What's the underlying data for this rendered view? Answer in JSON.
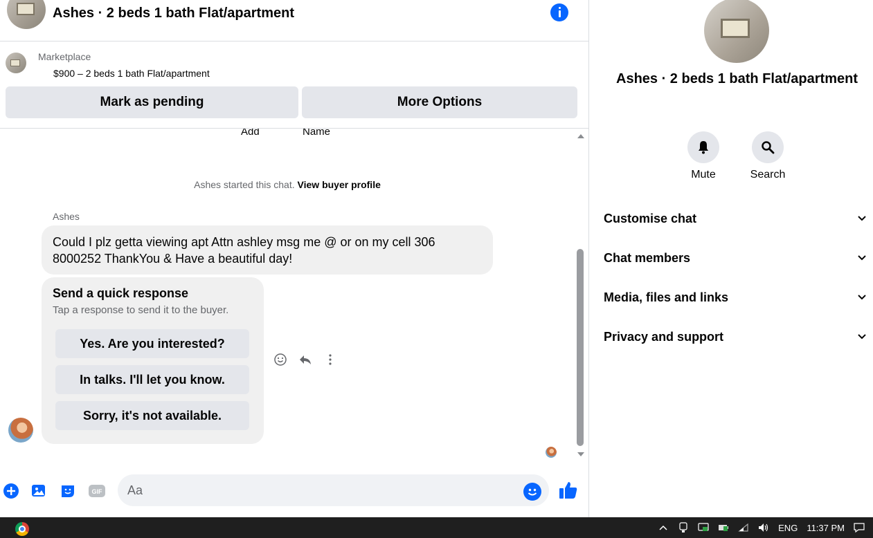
{
  "header": {
    "title": "Ashes · 2 beds 1 bath Flat/apartment"
  },
  "listing": {
    "source": "Marketplace",
    "price_title": "$900 – 2 beds 1 bath Flat/apartment",
    "mark_pending_label": "Mark as pending",
    "more_options_label": "More Options"
  },
  "messages": {
    "clipped_label_1": "Add",
    "clipped_label_2": "Name",
    "started_text": "Ashes started this chat.",
    "view_profile": "View buyer profile",
    "sender_name": "Ashes",
    "message_text": "Could I plz getta viewing apt Attn ashley msg me @ or on my cell 306 8000252 ThankYou & Have a beautiful day!",
    "quick_title": "Send a quick response",
    "quick_subtitle": "Tap a response to send it to the buyer.",
    "quick_responses": [
      "Yes. Are you interested?",
      "In talks. I'll let you know.",
      "Sorry, it's not available."
    ]
  },
  "composer": {
    "placeholder": "Aa"
  },
  "right_panel": {
    "title": "Ashes · 2 beds 1 bath Flat/apartment",
    "mute_label": "Mute",
    "search_label": "Search",
    "sections": [
      "Customise chat",
      "Chat members",
      "Media, files and links",
      "Privacy and support"
    ]
  },
  "taskbar": {
    "language": "ENG",
    "time": "11:37 PM"
  },
  "colors": {
    "accent": "#0866ff",
    "button_bg": "#e4e6eb",
    "bubble_bg": "#f0f0f0",
    "secondary_text": "#65676b"
  }
}
